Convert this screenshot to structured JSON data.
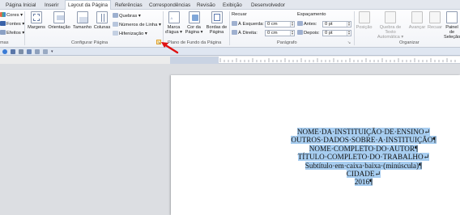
{
  "tabs": [
    {
      "label": "Página Inicial"
    },
    {
      "label": "Inserir"
    },
    {
      "label": "Layout da Página",
      "active": true
    },
    {
      "label": "Referências"
    },
    {
      "label": "Correspondências"
    },
    {
      "label": "Revisão"
    },
    {
      "label": "Exibição"
    },
    {
      "label": "Desenvolvedor"
    }
  ],
  "ribbon": {
    "temas": {
      "cores": "Cores ▾",
      "fontes": "Fontes ▾",
      "efeitos": "Efeitos ▾",
      "group_label": "mas"
    },
    "configurar": {
      "margens": "Margens",
      "orientacao": "Orientação",
      "tamanho": "Tamanho",
      "colunas": "Colunas",
      "quebras": "Quebras ▾",
      "numeros_linha": "Números de Linha ▾",
      "hifenizacao": "Hifenização ▾",
      "group_label": "Configurar Página"
    },
    "plano_fundo": {
      "marca_dagua": "Marca d'água ▾",
      "cor_pagina": "Cor da Página ▾",
      "bordas_pagina": "Bordas de Página",
      "group_label": "Plano de Fundo da Página"
    },
    "paragrafo": {
      "recuar": "Recuar",
      "esquerda_label": "À Esquerda:",
      "esquerda_value": "0 cm",
      "direita_label": "À Direita:",
      "direita_value": "0 cm",
      "espacamento": "Espaçamento",
      "antes_label": "Antes:",
      "antes_value": "0 pt",
      "depois_label": "Depois:",
      "depois_value": "0 pt",
      "group_label": "Parágrafo"
    },
    "organizar": {
      "posicao": "Posição",
      "quebra_texto": "Quebra de Texto Automática ▾",
      "avancar": "Avançar",
      "recuar": "Recuar",
      "painel_selecao": "Painel de Seleção",
      "group_label": "Organizar"
    }
  },
  "document": {
    "lines": [
      "NOME·DA·INSTITUIÇÃO·DE·ENSINO↵",
      "OUTROS·DADOS·SOBRE·A·INSTITUIÇÃO¶",
      "NOME·COMPLETO·DO·AUTOR¶",
      "TÍTULO·COMPLETO·DO·TRABALHO↵",
      "Subtítulo·em·caixa·baixa·(minúscula)¶",
      "CIDADE↵",
      "2016¶"
    ]
  },
  "colors": {
    "selection": "#a7cdf0",
    "arrow": "#e01010",
    "ribbon_border": "#c3c9d4"
  }
}
